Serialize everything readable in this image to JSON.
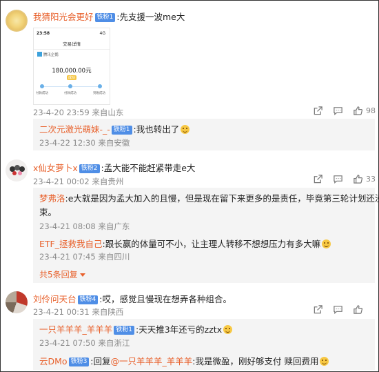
{
  "comments": [
    {
      "username": "我猜阳光会更好",
      "badge": "铁粉1",
      "text": ":先支援一波me大",
      "time": "23-4-20 23:59",
      "location": "来自山东",
      "likes": "98",
      "screenshot": {
        "status_time": "23:58",
        "status_right": "4G",
        "title": "交易详情",
        "source": "腾讯企鹅",
        "amount": "180,000.00元",
        "badge": "成功",
        "steps": [
          "付款成功",
          "付款成功",
          "到账成功"
        ]
      },
      "replies": [
        {
          "username": "二次元激光萌妹-_-",
          "badge": "铁粉1",
          "text": ":我也转出了",
          "emoji": "laugh-emoji",
          "time": "23-4-22 12:30",
          "location": "来自安徽"
        }
      ]
    },
    {
      "username": "x仙女萝卜x",
      "badge": "铁粉2",
      "text": ":孟大能不能赶紧带走e大",
      "time": "23-4-21 00:02",
      "location": "来自贵州",
      "likes": "33",
      "replies": [
        {
          "username": "梦弗洛",
          "text_line1": ":e大就是因为孟大加入的且慢，但是现在留下来更多的是责任，毕竟第三轮计划还没结",
          "text_line2": "束。",
          "time": "23-4-21 08:08",
          "location": "来自广东"
        },
        {
          "username": "ETF_拯救我自己",
          "text": ":跟长赢的体量可不小，让主理人转移不想想压力有多大嘛",
          "emoji": "laugh-emoji",
          "time": "23-4-21 07:45",
          "location": "来自四川"
        }
      ],
      "more_replies": "共5条回复"
    },
    {
      "username": "刘伶问天台",
      "badge": "铁粉4",
      "text": ":哎，感觉且慢现在想弄各种组合。",
      "time": "23-4-21 00:31",
      "location": "来自陕西",
      "replies": [
        {
          "username": "一只羊羊羊_羊羊羊",
          "badge": "铁粉1",
          "text": ":天天推3年还亏的zztx",
          "emoji": "laugh-emoji",
          "time": "23-4-21 07:50",
          "location": "来自浙江"
        },
        {
          "username": "云DMo",
          "badge": "铁粉3",
          "text_prefix": ":回复",
          "mention": "@一只羊羊羊_羊羊羊",
          "text": ":我是微盈，刚好够支付 赎回费用",
          "emoji": "grin-emoji"
        }
      ]
    }
  ],
  "colors": {
    "username": "#e8612c",
    "badge": "#4f8ee6",
    "meta": "#8a8a8a",
    "reply_bg": "#f4f4f4"
  }
}
